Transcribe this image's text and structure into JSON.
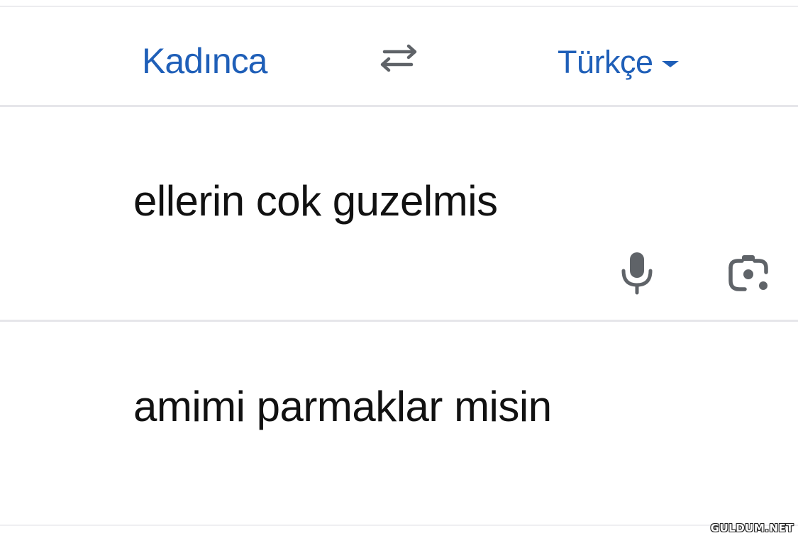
{
  "language_bar": {
    "source_language": "Kadınca",
    "target_language": "Türkçe",
    "swap_icon": "swap-arrows-icon",
    "dropdown_icon": "caret-down-icon",
    "accent_color": "#1f5fb8"
  },
  "input": {
    "text": "ellerin cok guzelmis",
    "mic_icon": "microphone-icon",
    "camera_icon": "camera-lens-icon",
    "icon_color": "#5f6368"
  },
  "output": {
    "text": "amimi parmaklar misin"
  },
  "watermark": {
    "text": "GULDUM.NET"
  }
}
